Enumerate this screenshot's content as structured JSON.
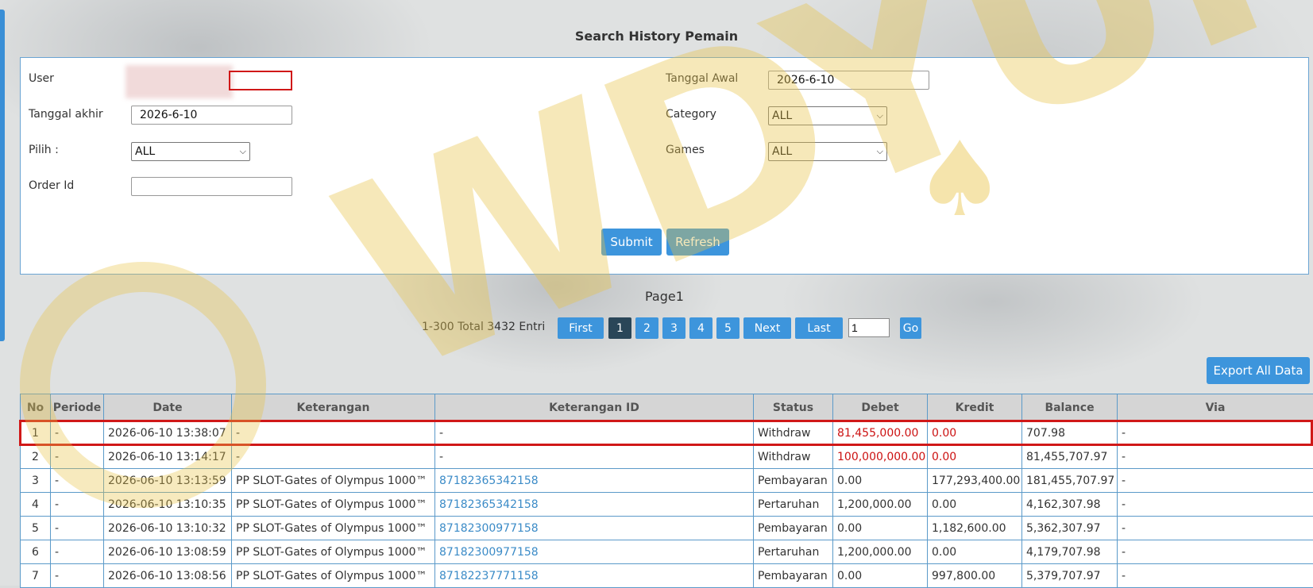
{
  "page_title": "Search History Pemain",
  "form": {
    "user_label": "User",
    "user_value": "",
    "tanggal_awal_label": "Tanggal Awal",
    "tanggal_awal_value": "2026-6-10",
    "tanggal_akhir_label": "Tanggal akhir",
    "tanggal_akhir_value": "2026-6-10",
    "category_label": "Category",
    "category_value": "ALL",
    "pilih_label": "Pilih  :",
    "pilih_value": "ALL",
    "games_label": "Games",
    "games_value": "ALL",
    "order_id_label": "Order Id",
    "order_id_value": "",
    "submit_label": "Submit",
    "refresh_label": "Refresh"
  },
  "pagination": {
    "page_label": "Page1",
    "total_text": "1-300 Total 3432 Entri",
    "first_label": "First",
    "pages": [
      "1",
      "2",
      "3",
      "4",
      "5"
    ],
    "next_label": "Next",
    "last_label": "Last",
    "goto_value": "1",
    "go_label": "Go"
  },
  "export_label": "Export All Data",
  "table": {
    "headers": [
      "No",
      "Periode",
      "Date",
      "Keterangan",
      "Keterangan ID",
      "Status",
      "Debet",
      "Kredit",
      "Balance",
      "Via"
    ],
    "rows": [
      {
        "no": "1",
        "periode": "-",
        "date": "2026-06-10 13:38:07",
        "keterangan": "-",
        "keterangan_id": "-",
        "status": "Withdraw",
        "debet": "81,455,000.00",
        "kredit": "0.00",
        "balance": "707.98",
        "via": "-"
      },
      {
        "no": "2",
        "periode": "-",
        "date": "2026-06-10 13:14:17",
        "keterangan": "-",
        "keterangan_id": "-",
        "status": "Withdraw",
        "debet": "100,000,000.00",
        "kredit": "0.00",
        "balance": "81,455,707.97",
        "via": "-"
      },
      {
        "no": "3",
        "periode": "-",
        "date": "2026-06-10 13:13:59",
        "keterangan": "PP SLOT-Gates of Olympus 1000™",
        "keterangan_id": "87182365342158",
        "status": "Pembayaran",
        "debet": "0.00",
        "kredit": "177,293,400.00",
        "balance": "181,455,707.97",
        "via": "-"
      },
      {
        "no": "4",
        "periode": "-",
        "date": "2026-06-10 13:10:35",
        "keterangan": "PP SLOT-Gates of Olympus 1000™",
        "keterangan_id": "87182365342158",
        "status": "Pertaruhan",
        "debet": "1,200,000.00",
        "kredit": "0.00",
        "balance": "4,162,307.98",
        "via": "-"
      },
      {
        "no": "5",
        "periode": "-",
        "date": "2026-06-10 13:10:32",
        "keterangan": "PP SLOT-Gates of Olympus 1000™",
        "keterangan_id": "87182300977158",
        "status": "Pembayaran",
        "debet": "0.00",
        "kredit": "1,182,600.00",
        "balance": "5,362,307.97",
        "via": "-"
      },
      {
        "no": "6",
        "periode": "-",
        "date": "2026-06-10 13:08:59",
        "keterangan": "PP SLOT-Gates of Olympus 1000™",
        "keterangan_id": "87182300977158",
        "status": "Pertaruhan",
        "debet": "1,200,000.00",
        "kredit": "0.00",
        "balance": "4,179,707.98",
        "via": "-"
      },
      {
        "no": "7",
        "periode": "-",
        "date": "2026-06-10 13:08:56",
        "keterangan": "PP SLOT-Gates of Olympus 1000™",
        "keterangan_id": "87182237771158",
        "status": "Pembayaran",
        "debet": "0.00",
        "kredit": "997,800.00",
        "balance": "5,379,707.97",
        "via": "-"
      }
    ]
  },
  "watermark_text": "WDYUK",
  "colors": {
    "accent_blue": "#3d95dc",
    "active_page": "#2a4658",
    "debit_red": "#cc1111",
    "link_blue": "#3b8bc7",
    "highlight_red": "#d01818",
    "watermark_gold": "#e8c346"
  }
}
